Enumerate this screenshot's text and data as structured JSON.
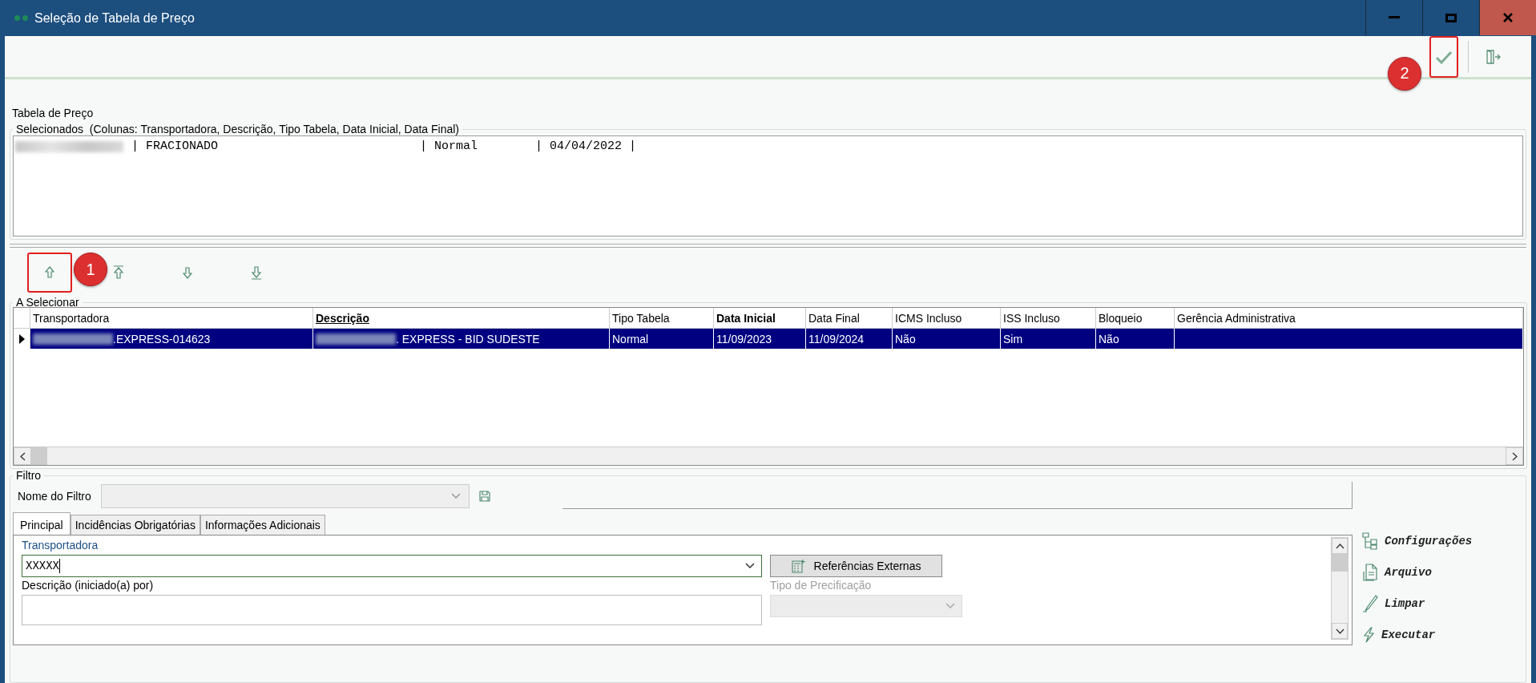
{
  "window": {
    "title": "Seleção de Tabela de Preço"
  },
  "toolbar": [
    {
      "kind": "confirm",
      "highlighted": true,
      "callout": "2"
    },
    {
      "kind": "exit",
      "highlighted": false
    }
  ],
  "section_title": "Tabela de Preço",
  "selected_group": {
    "legend": "Selecionados  (Colunas: Transportadora, Descrição, Tipo Tabela, Data Inicial, Data Final)",
    "lines": [
      {
        "redacted": true,
        "text": "| FRACIONADO                            | Normal        | 04/04/2022 |"
      }
    ]
  },
  "move_buttons": [
    {
      "kind": "up",
      "highlighted": true,
      "callout": "1"
    },
    {
      "kind": "all_up",
      "highlighted": false
    },
    {
      "kind": "down",
      "highlighted": false
    },
    {
      "kind": "all_down",
      "highlighted": false
    }
  ],
  "grid": {
    "legend": "A Selecionar",
    "columns": [
      {
        "label": "Transportadora",
        "bold": false
      },
      {
        "label": "Descrição",
        "bold": true
      },
      {
        "label": "Tipo Tabela",
        "bold": false
      },
      {
        "label": "Data Inicial",
        "bold": true
      },
      {
        "label": "Data Final",
        "bold": false
      },
      {
        "label": "ICMS Incluso",
        "bold": false
      },
      {
        "label": "ISS Incluso",
        "bold": false
      },
      {
        "label": "Bloqueio",
        "bold": false
      },
      {
        "label": "Gerência Administrativa",
        "bold": false
      }
    ],
    "rows": [
      {
        "selected": true,
        "cells": [
          {
            "text": ".EXPRESS-014623",
            "redacted": true
          },
          {
            "text": ". EXPRESS - BID SUDESTE",
            "redacted": true
          },
          {
            "text": "Normal",
            "redacted": false
          },
          {
            "text": "11/09/2023",
            "redacted": false
          },
          {
            "text": "11/09/2024",
            "redacted": false
          },
          {
            "text": "Não",
            "redacted": false
          },
          {
            "text": "Sim",
            "redacted": false
          },
          {
            "text": "Não",
            "redacted": false
          }
        ]
      }
    ]
  },
  "filter": {
    "legend": "Filtro",
    "name_label": "Nome do Filtro",
    "name_field": {
      "disabled": true
    },
    "tabs": [
      {
        "label": "Principal",
        "selected": true
      },
      {
        "label": "Incidências Obrigatórias",
        "selected": false
      },
      {
        "label": "Informações Adicionais",
        "selected": false
      }
    ],
    "fields": [
      {
        "kind": "combo",
        "label": "Transportadora",
        "value": "XXXXX",
        "focused": true,
        "disabled": false
      },
      {
        "kind": "text",
        "label": "Descrição (iniciado(a) por)",
        "focused": false,
        "disabled": false
      },
      {
        "kind": "combo",
        "label": "Tipo de Precificação",
        "focused": false,
        "disabled": true
      }
    ],
    "external_button": "Referências Externas"
  },
  "actions": [
    {
      "kind": "settings",
      "label": "Configurações"
    },
    {
      "kind": "file",
      "label": "Arquivo"
    },
    {
      "kind": "clear",
      "label": "Limpar"
    },
    {
      "kind": "run",
      "label": "Executar"
    }
  ]
}
